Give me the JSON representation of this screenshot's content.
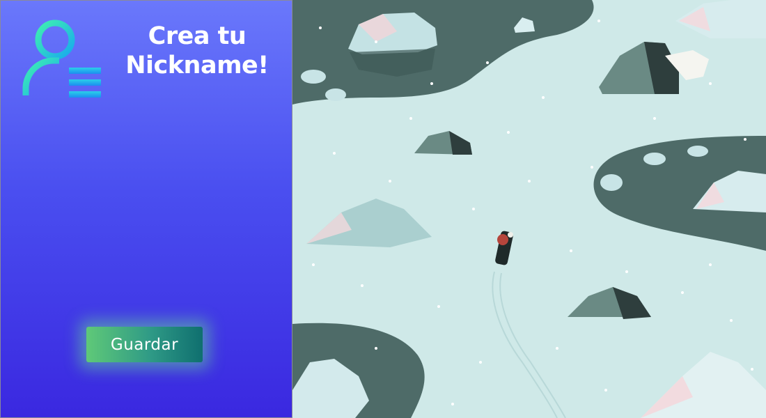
{
  "panel": {
    "title_line1": "Crea tu",
    "title_line2": "Nickname!",
    "icon": "user-list-icon",
    "save_label": "Guardar"
  },
  "scene": {
    "description_icon": "arctic-snowmobile-illustration"
  },
  "colors": {
    "panel_top": "#6a78fb",
    "panel_bottom": "#3a28e0",
    "button_start": "#5fc978",
    "button_end": "#0f6f6f",
    "snow": "#cfe9e8",
    "water": "#4e6b68"
  }
}
